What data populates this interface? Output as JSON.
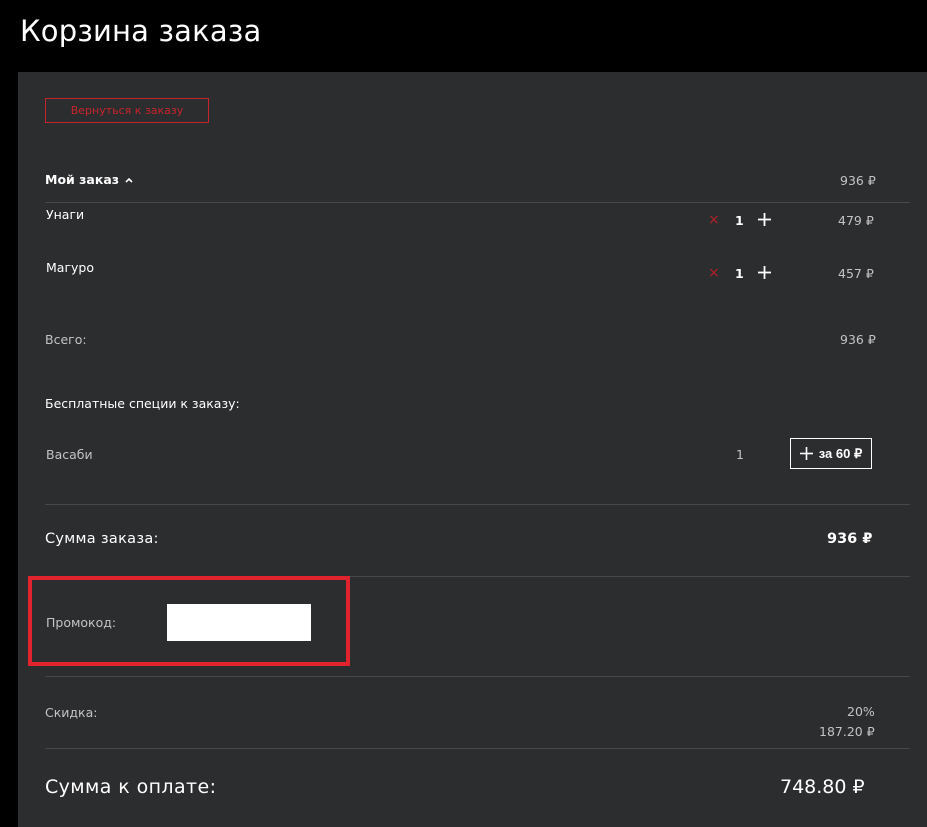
{
  "header": {
    "title": "Корзина заказа"
  },
  "actions": {
    "back_label": "Вернуться к заказу"
  },
  "order": {
    "title": "Мой заказ",
    "header_total": "936 ₽",
    "items": [
      {
        "name": "Унаги",
        "qty": "1",
        "price": "479 ₽"
      },
      {
        "name": "Магуро",
        "qty": "1",
        "price": "457 ₽"
      }
    ],
    "total_label": "Всего:",
    "total_value": "936 ₽"
  },
  "spices": {
    "title": "Бесплатные специи к заказу:",
    "items": [
      {
        "name": "Васаби",
        "qty": "1",
        "add_label": "за 60 ₽"
      }
    ]
  },
  "summary": {
    "order_sum_label": "Сумма заказа:",
    "order_sum_value": "936 ₽",
    "promo_label": "Промокод:",
    "promo_value": "",
    "promo_placeholder": "",
    "discount_label": "Скидка:",
    "discount_percent": "20%",
    "discount_amount": "187.20 ₽",
    "pay_label": "Сумма к оплате:",
    "pay_value": "748.80 ₽"
  },
  "colors": {
    "accent": "#c8242b",
    "highlight": "#e0232c",
    "panel": "#2c2d2f",
    "background": "#000000"
  }
}
